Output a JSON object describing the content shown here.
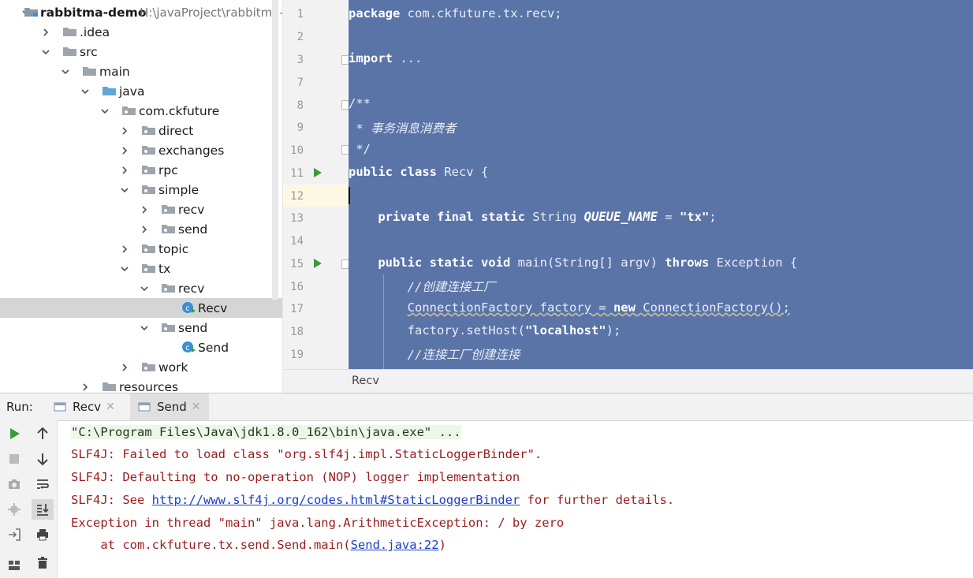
{
  "project": {
    "name": "rabbitma-demo",
    "path": "H:\\javaProject\\rabbitma-",
    "rows": [
      {
        "label": "rabbitma-demo",
        "indent": 0,
        "expanded": true,
        "icon": "module-icon"
      },
      {
        "label": ".idea",
        "indent": 1,
        "expanded": false,
        "icon": "folder-icon"
      },
      {
        "label": "src",
        "indent": 1,
        "expanded": true,
        "icon": "folder-icon"
      },
      {
        "label": "main",
        "indent": 2,
        "expanded": true,
        "icon": "folder-icon"
      },
      {
        "label": "java",
        "indent": 3,
        "expanded": true,
        "icon": "source-folder-icon"
      },
      {
        "label": "com.ckfuture",
        "indent": 4,
        "expanded": true,
        "icon": "package-icon"
      },
      {
        "label": "direct",
        "indent": 5,
        "expanded": false,
        "icon": "package-icon"
      },
      {
        "label": "exchanges",
        "indent": 5,
        "expanded": false,
        "icon": "package-icon"
      },
      {
        "label": "rpc",
        "indent": 5,
        "expanded": false,
        "icon": "package-icon"
      },
      {
        "label": "simple",
        "indent": 5,
        "expanded": true,
        "icon": "package-icon"
      },
      {
        "label": "recv",
        "indent": 6,
        "expanded": false,
        "icon": "package-icon"
      },
      {
        "label": "send",
        "indent": 6,
        "expanded": false,
        "icon": "package-icon"
      },
      {
        "label": "topic",
        "indent": 5,
        "expanded": false,
        "icon": "package-icon"
      },
      {
        "label": "tx",
        "indent": 5,
        "expanded": true,
        "icon": "package-icon"
      },
      {
        "label": "recv",
        "indent": 6,
        "expanded": true,
        "icon": "package-icon"
      },
      {
        "label": "Recv",
        "indent": 7,
        "expanded": null,
        "icon": "java-class-icon",
        "selected": true
      },
      {
        "label": "send",
        "indent": 6,
        "expanded": true,
        "icon": "package-icon"
      },
      {
        "label": "Send",
        "indent": 7,
        "expanded": null,
        "icon": "java-class-icon"
      },
      {
        "label": "work",
        "indent": 5,
        "expanded": false,
        "icon": "package-icon"
      },
      {
        "label": "resources",
        "indent": 3,
        "expanded": false,
        "icon": "folder-icon"
      }
    ]
  },
  "editor": {
    "line_numbers": [
      "1",
      "2",
      "3",
      "7",
      "8",
      "9",
      "10",
      "11",
      "12",
      "13",
      "14",
      "15",
      "16",
      "17",
      "18",
      "19"
    ],
    "breadcrumb": "Recv"
  },
  "run": {
    "label": "Run:",
    "tabs": [
      {
        "label": "Recv",
        "active": false
      },
      {
        "label": "Send",
        "active": true
      }
    ],
    "console": {
      "cmd": "\"C:\\Program Files\\Java\\jdk1.8.0_162\\bin\\java.exe\" ...",
      "l1": "SLF4J: Failed to load class \"org.slf4j.impl.StaticLoggerBinder\".",
      "l2": "SLF4J: Defaulting to no-operation (NOP) logger implementation",
      "l3_pre": "SLF4J: See ",
      "l3_link": "http://www.slf4j.org/codes.html#StaticLoggerBinder",
      "l3_post": " for further details.",
      "l4": "Exception in thread \"main\" java.lang.ArithmeticException: / by zero",
      "l5_pre": "    at com.ckfuture.tx.send.Send.main(",
      "l5_link": "Send.java:22",
      "l5_post": ")"
    }
  },
  "colors": {
    "selection": "#5a74a8",
    "error_text": "#9b1c1c",
    "link": "#1a3ec7",
    "run_green": "#3c9a3c"
  }
}
